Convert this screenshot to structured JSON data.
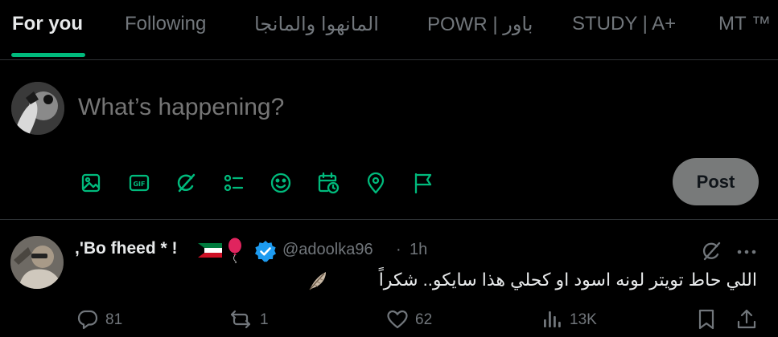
{
  "tabs": [
    {
      "label": "For you",
      "active": true
    },
    {
      "label": "Following"
    },
    {
      "label": "المانهوا والمانجا"
    },
    {
      "label": "POWR | باور"
    },
    {
      "label": "STUDY | A+"
    },
    {
      "label": "MT ™"
    }
  ],
  "composer": {
    "placeholder": "What’s happening?",
    "tools": [
      "image-icon",
      "gif-icon",
      "grok-icon",
      "poll-icon",
      "emoji-icon",
      "schedule-icon",
      "location-icon",
      "flag-icon"
    ],
    "post_label": "Post"
  },
  "tweet": {
    "name": ",'Bo fheed * !",
    "handle": "@adoolka96",
    "separator": "·",
    "time": "1h",
    "text": "اللي حاط تويتر لونه اسود او كحلي هذا سايكو.. شكراً",
    "stats": {
      "replies": "81",
      "reposts": "1",
      "likes": "62",
      "views": "13K"
    }
  },
  "colors": {
    "accent": "#00ba7c",
    "verified": "#1d9bf0",
    "muted": "#71767b",
    "text": "#e7e9ea",
    "post_button": "#787a7a"
  }
}
